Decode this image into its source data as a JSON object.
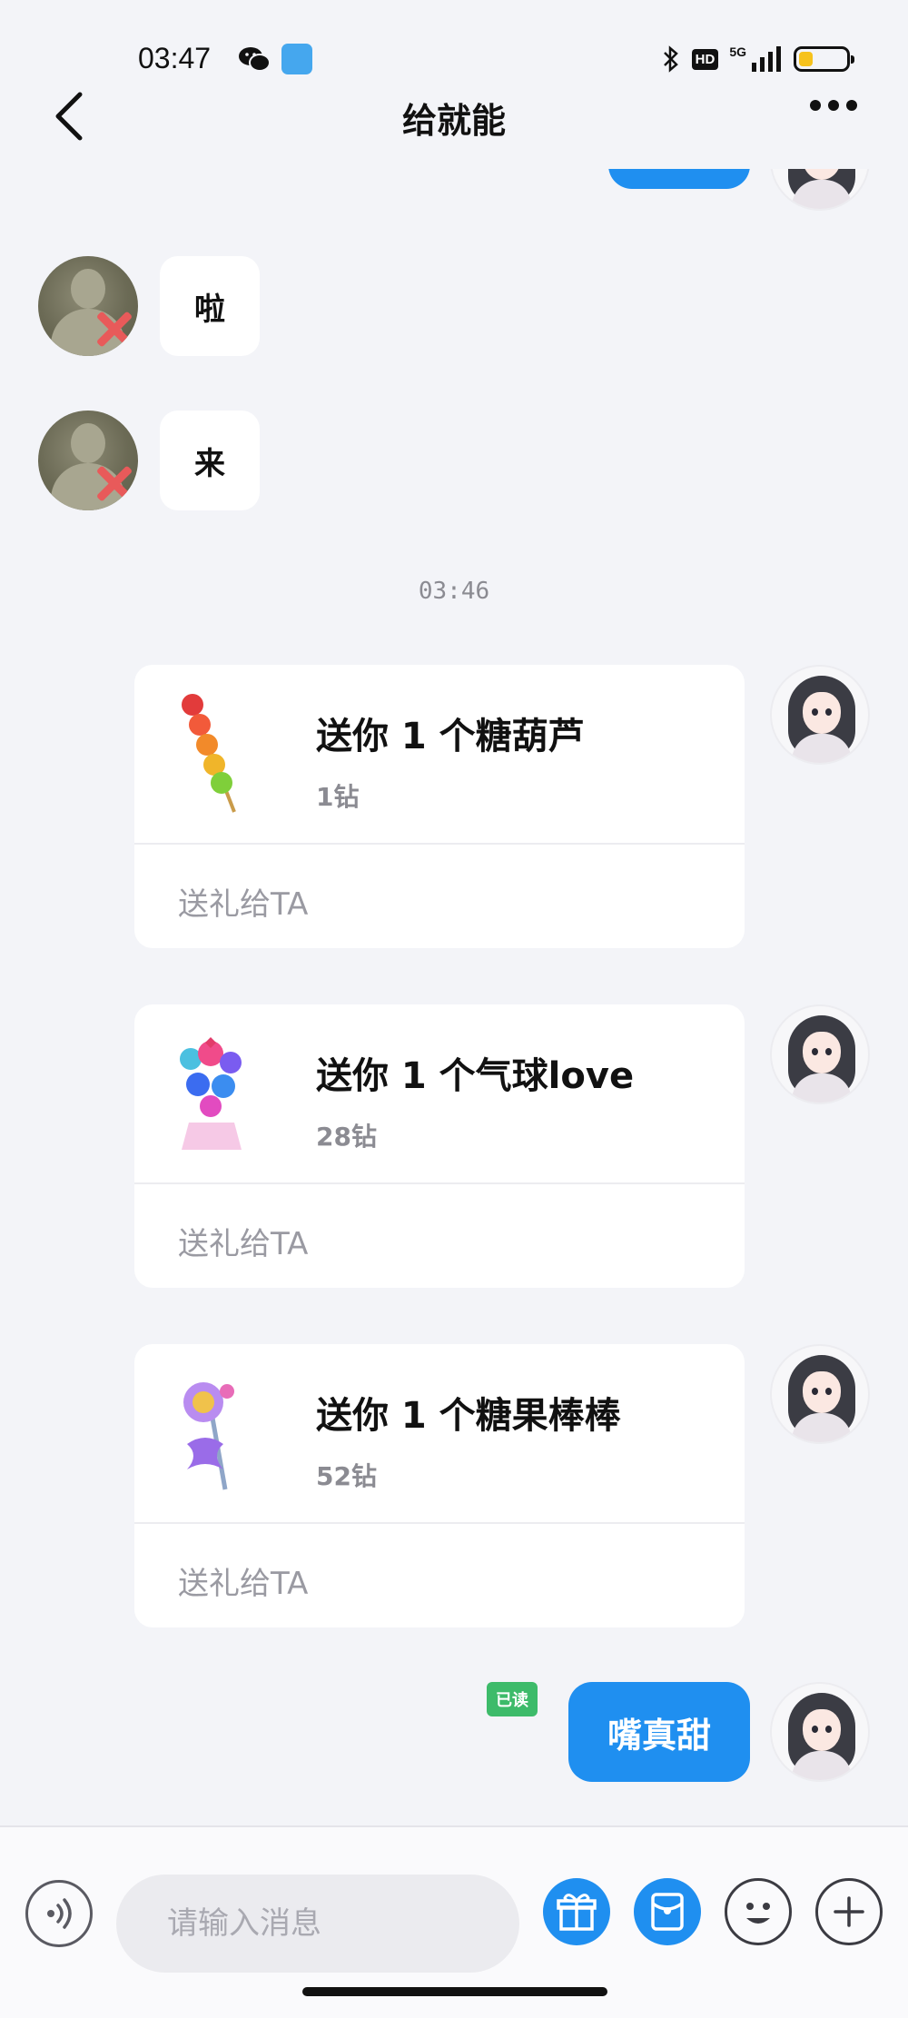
{
  "status_bar": {
    "time": "03:47",
    "network": "5G",
    "hd": "HD",
    "battery_level": 0.3,
    "battery_color": "#f6c21c",
    "icons": [
      "wechat-icon",
      "app-icon",
      "bluetooth-icon",
      "signal-icon",
      "battery-icon"
    ]
  },
  "nav": {
    "title": "给就能",
    "back_icon": "chevron-left-icon",
    "more_icon": "more-dots-icon"
  },
  "messages": {
    "incoming": [
      {
        "text": "啦"
      },
      {
        "text": "来"
      }
    ],
    "time_separator": "03:46",
    "gifts": [
      {
        "title": "送你 1 个糖葫芦",
        "price": "1钻",
        "action": "送礼给TA",
        "icon": "tanghulu-icon"
      },
      {
        "title": "送你 1 个气球love",
        "price": "28钻",
        "action": "送礼给TA",
        "icon": "balloon-love-icon"
      },
      {
        "title": "送你 1 个糖果棒棒",
        "price": "52钻",
        "action": "送礼给TA",
        "icon": "candy-wand-icon"
      }
    ],
    "outgoing_last": {
      "text": "嘴真甜",
      "read_label": "已读"
    }
  },
  "input_bar": {
    "placeholder": "请输入消息",
    "buttons": [
      "voice-icon",
      "gift-icon",
      "red-packet-icon",
      "emoji-icon",
      "plus-icon"
    ]
  },
  "colors": {
    "accent": "#1f8ff0",
    "background": "#f3f4f8",
    "read_badge": "#3dbb6a"
  }
}
